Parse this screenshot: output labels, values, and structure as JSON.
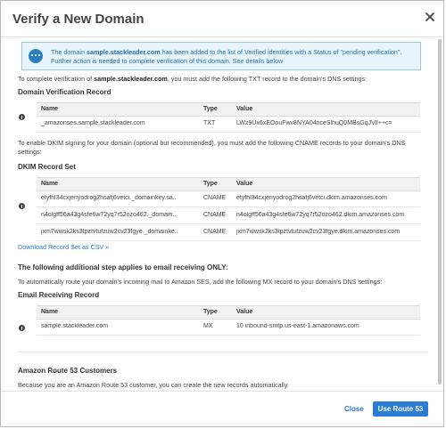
{
  "modal": {
    "title": "Verify a New Domain"
  },
  "info": {
    "prefix": "The domain ",
    "domain": "sample.stackleader.com",
    "suffix": " has been added to the list of Verified identities with a Status of \"pending verification\". Further action is needed to complete verification of this domain. ",
    "link": "See details below"
  },
  "txt_section": {
    "intro_prefix": "To complete verification of ",
    "intro_domain": "sample.stackleader.com",
    "intro_suffix": ", you must add the following TXT record to the domain's DNS settings:",
    "title": "Domain Verification Record",
    "headers": [
      "Name",
      "Type",
      "Value"
    ],
    "rows": [
      {
        "name": "_amazonses.sample.stackleader.com",
        "type": "TXT",
        "value": "LWz9Ux6xEOouFwv8NYA04nceSlhuQ0MBsGqJVll++c="
      }
    ]
  },
  "dkim_section": {
    "intro": "To enable DKIM signing for your domain (optional but recommended), you must add the following CNAME records to your domain's DNS settings:",
    "title": "DKIM Record Set",
    "headers": [
      "Name",
      "Type",
      "Value"
    ],
    "rows": [
      {
        "name": "etyfhl34cxjeriyodrog2hsafj6vetci._domainkey.sa..",
        "type": "CNAME",
        "value": "etyfhl34cxjeriyodrog2hsafj6vetci.dkim.amazonses.com"
      },
      {
        "name": "n4olgff56a43g4sfe6w72yq7r52ozo462._domain..",
        "type": "CNAME",
        "value": "n4olgff56a43g4sfe6w72yq7r52ozo462.dkim.amazonses.com"
      },
      {
        "name": "jxm7wwsk2ks3tpztvtufzuw2cv23fgye._domainke..",
        "type": "CNAME",
        "value": "jxm7wwsk2ks3tpztvtufzuw2cv23fgye.dkim.amazonses.com"
      }
    ],
    "download_link": "Download Record Set as CSV »"
  },
  "email_section": {
    "heading": "The following additional step applies to email receiving ONLY:",
    "intro": "To automatically route your domain's incoming mail to Amazon SES, add the following MX record to your domain's DNS settings:",
    "title": "Email Receiving Record",
    "headers": [
      "Name",
      "Type",
      "Value"
    ],
    "rows": [
      {
        "name": "sample.stackleader.com",
        "type": "MX",
        "value": "10 inbound-smtp.us-east-1.amazonaws.com"
      }
    ]
  },
  "route53_section": {
    "title": "Amazon Route 53 Customers",
    "text": "Because you are an Amazon Route 53 customer, you can create the new records automatically."
  },
  "footer": {
    "close_label": "Close",
    "primary_label": "Use Route 53"
  },
  "colors": {
    "accent": "#2b7cd3",
    "link": "#2a73c5",
    "info_bg": "#e8f4fb"
  }
}
